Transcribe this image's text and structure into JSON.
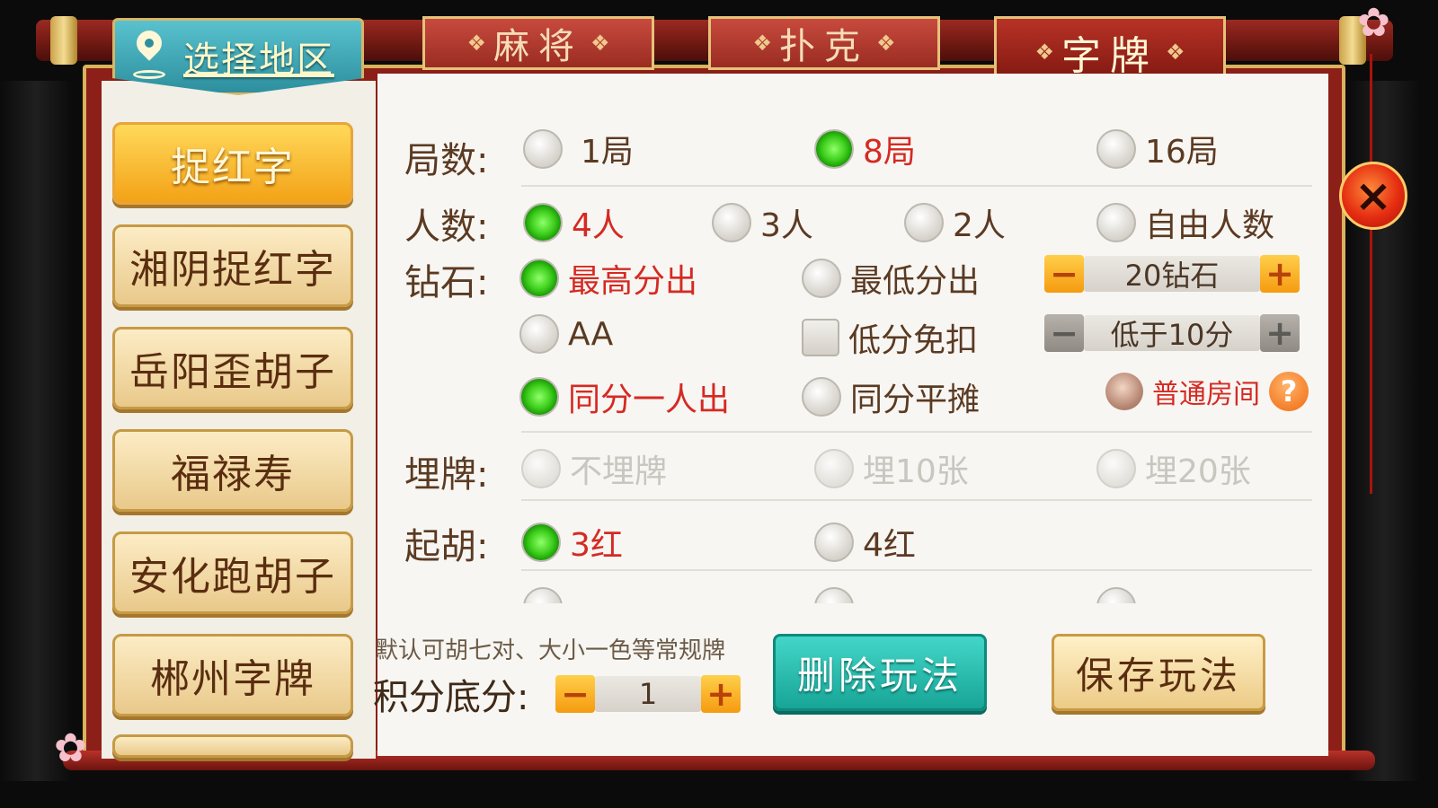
{
  "region": {
    "label": "选择地区"
  },
  "tabs": [
    {
      "label": "麻将",
      "active": false
    },
    {
      "label": "扑克",
      "active": false
    },
    {
      "label": "字牌",
      "active": true
    }
  ],
  "games": [
    {
      "label": "捉红字",
      "active": true
    },
    {
      "label": "湘阴捉红字",
      "active": false
    },
    {
      "label": "岳阳歪胡子",
      "active": false
    },
    {
      "label": "福禄寿",
      "active": false
    },
    {
      "label": "安化跑胡子",
      "active": false
    },
    {
      "label": "郴州字牌",
      "active": false
    }
  ],
  "rounds": {
    "label": "局数:",
    "options": [
      "1局",
      "8局",
      "16局"
    ],
    "selected": "8局"
  },
  "players": {
    "label": "人数:",
    "options": [
      "4人",
      "3人",
      "2人",
      "自由人数"
    ],
    "selected": "4人"
  },
  "diamond": {
    "label": "钻石:",
    "options": [
      "最高分出",
      "最低分出"
    ],
    "selected": "最高分出",
    "stepper_value": "20钻石",
    "aa_label": "AA",
    "low_score_exempt": "低分免扣",
    "low_score_stepper": "低于10分",
    "tie_options": [
      "同分一人出",
      "同分平摊"
    ],
    "tie_selected": "同分一人出",
    "room_type": "普通房间",
    "help_symbol": "?"
  },
  "bury": {
    "label": "埋牌:",
    "options": [
      "不埋牌",
      "埋10张",
      "埋20张"
    ]
  },
  "qihu": {
    "label": "起胡:",
    "options": [
      "3红",
      "4红"
    ],
    "selected": "3红"
  },
  "stepper_symbols": {
    "minus": "−",
    "plus": "+"
  },
  "footer": {
    "note": "默认可胡七对、大小一色等常规牌",
    "base_score_label": "积分底分:",
    "base_score_value": "1",
    "delete_label": "删除玩法",
    "save_label": "保存玩法"
  },
  "close_symbol": "×",
  "colors": {
    "selected_text": "#d52a22",
    "accent_teal": "#17a596",
    "accent_orange": "#f59b10",
    "frame_red": "#8c1f17"
  }
}
